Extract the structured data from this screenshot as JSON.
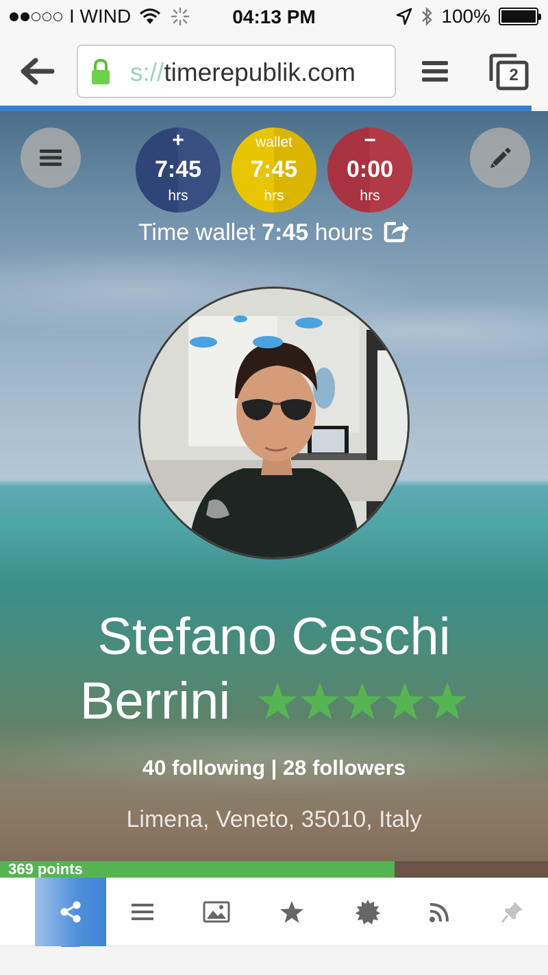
{
  "status_bar": {
    "signal_dots": [
      true,
      true,
      false,
      false,
      false
    ],
    "carrier": "I WIND",
    "time": "04:13 PM",
    "battery": "100%"
  },
  "browser": {
    "url_prefix": "s://",
    "url_host": "timerepublik.com",
    "tab_count": "2",
    "progress_percent": 97
  },
  "wallet": {
    "plus": {
      "sign": "+",
      "value": "7:45",
      "unit": "hrs"
    },
    "wallet": {
      "label": "wallet",
      "value": "7:45",
      "unit": "hrs"
    },
    "minus": {
      "sign": "−",
      "value": "0:00",
      "unit": "hrs"
    },
    "line_prefix": "Time wallet",
    "line_value": "7:45",
    "line_suffix": "hours"
  },
  "profile": {
    "name_line1": "Stefano Ceschi",
    "name_line2": "Berrini",
    "rating_stars": 5,
    "star_color": "#56b552",
    "following_text": "40 following | 28 followers",
    "location": "Limena, Veneto, 35010, Italy",
    "points_label": "369 points",
    "points_progress_percent": 72
  },
  "tabs": [
    {
      "name": "share-icon",
      "active": true
    },
    {
      "name": "list-icon",
      "active": false
    },
    {
      "name": "image-icon",
      "active": false
    },
    {
      "name": "star-icon",
      "active": false
    },
    {
      "name": "badge-icon",
      "active": false
    },
    {
      "name": "rss-icon",
      "active": false
    },
    {
      "name": "pin-icon",
      "active": false
    }
  ],
  "colors": {
    "accent_blue": "#3f85d6",
    "wallet_plus": "#2f4577",
    "wallet_yellow": "#e9c400",
    "wallet_minus": "#a8323f",
    "points_green": "#56b552"
  }
}
